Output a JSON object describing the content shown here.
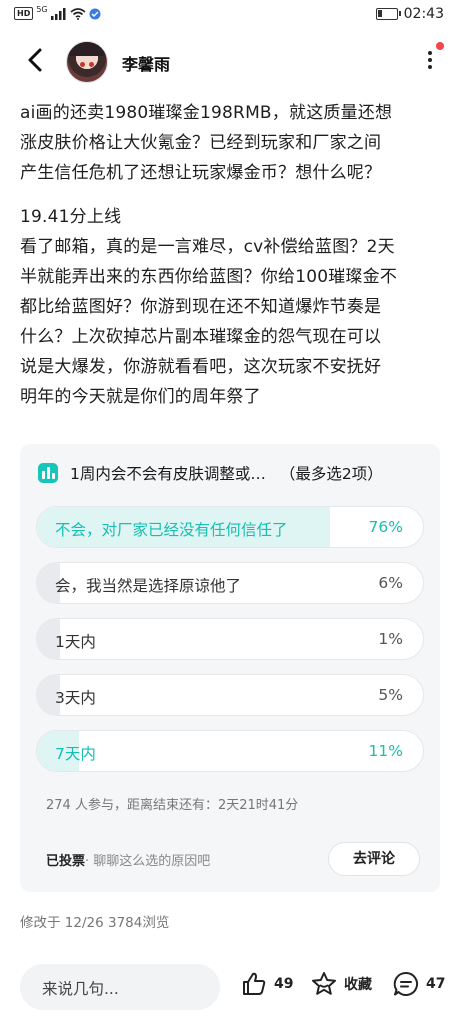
{
  "status_bar": {
    "left_badge": "HD",
    "network": "5G",
    "time": "02:43"
  },
  "header": {
    "username": "李馨雨",
    "back_icon": "chevron-left-icon",
    "more_icon": "more-vertical-icon"
  },
  "article": {
    "para1": [
      "ai画的还卖1980璀璨金198RMB，就这质量还想",
      "涨皮肤价格让大伙氪金？已经到玩家和厂家之间",
      "产生信任危机了还想让玩家爆金币？想什么呢？"
    ],
    "para2": [
      "19.41分上线",
      "看了邮箱，真的是一言难尽，cv补偿给蓝图？2天",
      "半就能弄出来的东西你给蓝图？你给100璀璨金不",
      "都比给蓝图好？你游到现在还不知道爆炸节奏是",
      "什么？上次砍掉芯片副本璀璨金的怨气现在可以",
      "说是大爆发，你游就看看吧，这次玩家不安抚好",
      "明年的今天就是你们的周年祭了"
    ]
  },
  "poll": {
    "title": "1周内会不会有皮肤调整或…",
    "limit": "（最多选2项）",
    "accent": "#15bfb2",
    "options": [
      {
        "label": "不会，对厂家已经没有任何信任了",
        "percent": "76%",
        "value": 76,
        "voted": true
      },
      {
        "label": "会，我当然是选择原谅他了",
        "percent": "6%",
        "value": 6,
        "voted": false
      },
      {
        "label": "1天内",
        "percent": "1%",
        "value": 1,
        "voted": false
      },
      {
        "label": "3天内",
        "percent": "5%",
        "value": 5,
        "voted": false
      },
      {
        "label": "7天内",
        "percent": "11%",
        "value": 11,
        "voted": true
      }
    ],
    "meta": "274 人参与，距离结束还有：2天21时41分",
    "voted_label": "已投票",
    "voted_hint": "· 聊聊这么选的原因吧",
    "comment_button": "去评论"
  },
  "modified": "修改于 12/26  3784浏览",
  "bottom_bar": {
    "input_placeholder": "来说几句...",
    "like_count": "49",
    "favorite_label": "收藏",
    "comment_count": "47"
  }
}
